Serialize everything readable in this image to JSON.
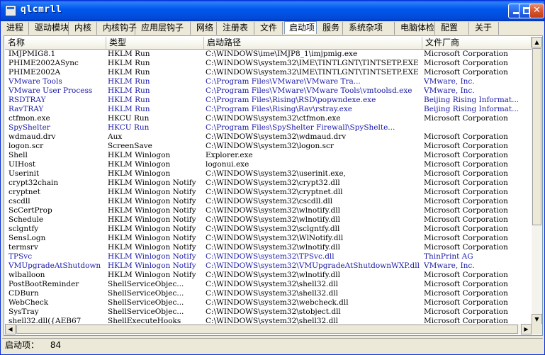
{
  "window": {
    "title": "qlcmrll"
  },
  "tabs": [
    "进程",
    "驱动模块",
    "内核",
    "内核钩子",
    "应用层钩子",
    "网络",
    "注册表",
    "文件",
    "启动项",
    "服务",
    "系统杂项",
    "电脑体检",
    "配置",
    "关于"
  ],
  "active_tab": "启动项",
  "columns": [
    "名称",
    "类型",
    "启动路径",
    "文件厂商"
  ],
  "rows": [
    {
      "name": "IMJPMIG8.1",
      "type": "HKLM Run",
      "path": "C:\\WINDOWS\\ime\\IMJP8_1\\imjpmig.exe",
      "vendor": "Microsoft Corporation",
      "highlight": false
    },
    {
      "name": "PHIME2002ASync",
      "type": "HKLM Run",
      "path": "C:\\WINDOWS\\system32\\IME\\TINTLGNT\\TINTSETP.EXE",
      "vendor": "Microsoft Corporation",
      "highlight": false
    },
    {
      "name": "PHIME2002A",
      "type": "HKLM Run",
      "path": "C:\\WINDOWS\\system32\\IME\\TINTLGNT\\TINTSETP.EXE",
      "vendor": "Microsoft Corporation",
      "highlight": false
    },
    {
      "name": "VMware Tools",
      "type": "HKLM Run",
      "path": "C:\\Program Files\\VMware\\VMware Tra...",
      "vendor": "VMware, Inc.",
      "highlight": true
    },
    {
      "name": "VMware User Process",
      "type": "HKLM Run",
      "path": "C:\\Program Files\\VMware\\VMware Tools\\vmtoolsd.exe",
      "vendor": "VMware, Inc.",
      "highlight": true
    },
    {
      "name": "RSDTRAY",
      "type": "HKLM Run",
      "path": "C:\\Program Files\\Rising\\RSD\\popwndexe.exe",
      "vendor": "Beijing Rising Informat...",
      "highlight": true
    },
    {
      "name": "RavTRAY",
      "type": "HKLM Run",
      "path": "C:\\Program Files\\Rising\\Rav\\rstray.exe",
      "vendor": "Beijing Rising Informat...",
      "highlight": true
    },
    {
      "name": "ctfmon.exe",
      "type": "HKCU Run",
      "path": "C:\\WINDOWS\\system32\\ctfmon.exe",
      "vendor": "Microsoft Corporation",
      "highlight": false
    },
    {
      "name": "SpyShelter",
      "type": "HKCU Run",
      "path": "C:\\Program Files\\SpyShelter Firewall\\SpyShelte...",
      "vendor": "",
      "highlight": true
    },
    {
      "name": "wdmaud.drv",
      "type": "Aux",
      "path": "C:\\WINDOWS\\system32\\wdmaud.drv",
      "vendor": "Microsoft Corporation",
      "highlight": false
    },
    {
      "name": "logon.scr",
      "type": "ScreenSave",
      "path": "C:\\WINDOWS\\system32\\logon.scr",
      "vendor": "Microsoft Corporation",
      "highlight": false
    },
    {
      "name": "Shell",
      "type": "HKLM Winlogon",
      "path": "Explorer.exe",
      "vendor": "Microsoft Corporation",
      "highlight": false
    },
    {
      "name": "UIHost",
      "type": "HKLM Winlogon",
      "path": "logonui.exe",
      "vendor": "Microsoft Corporation",
      "highlight": false
    },
    {
      "name": "Userinit",
      "type": "HKLM Winlogon",
      "path": "C:\\WINDOWS\\system32\\userinit.exe,",
      "vendor": "Microsoft Corporation",
      "highlight": false
    },
    {
      "name": "crypt32chain",
      "type": "HKLM Winlogon Notify",
      "path": "C:\\WINDOWS\\system32\\crypt32.dll",
      "vendor": "Microsoft Corporation",
      "highlight": false
    },
    {
      "name": "cryptnet",
      "type": "HKLM Winlogon Notify",
      "path": "C:\\WINDOWS\\system32\\cryptnet.dll",
      "vendor": "Microsoft Corporation",
      "highlight": false
    },
    {
      "name": "cscdll",
      "type": "HKLM Winlogon Notify",
      "path": "C:\\WINDOWS\\system32\\cscdll.dll",
      "vendor": "Microsoft Corporation",
      "highlight": false
    },
    {
      "name": "ScCertProp",
      "type": "HKLM Winlogon Notify",
      "path": "C:\\WINDOWS\\system32\\wlnotify.dll",
      "vendor": "Microsoft Corporation",
      "highlight": false
    },
    {
      "name": "Schedule",
      "type": "HKLM Winlogon Notify",
      "path": "C:\\WINDOWS\\system32\\wlnotify.dll",
      "vendor": "Microsoft Corporation",
      "highlight": false
    },
    {
      "name": "sclgntfy",
      "type": "HKLM Winlogon Notify",
      "path": "C:\\WINDOWS\\system32\\sclgntfy.dll",
      "vendor": "Microsoft Corporation",
      "highlight": false
    },
    {
      "name": "SensLogn",
      "type": "HKLM Winlogon Notify",
      "path": "C:\\WINDOWS\\system32\\WlNotify.dll",
      "vendor": "Microsoft Corporation",
      "highlight": false
    },
    {
      "name": "termsrv",
      "type": "HKLM Winlogon Notify",
      "path": "C:\\WINDOWS\\system32\\wlnotify.dll",
      "vendor": "Microsoft Corporation",
      "highlight": false
    },
    {
      "name": "TPSvc",
      "type": "HKLM Winlogon Notify",
      "path": "C:\\WINDOWS\\system32\\TPSvc.dll",
      "vendor": "ThinPrint AG",
      "highlight": true
    },
    {
      "name": "VMUpgradeAtShutdown",
      "type": "HKLM Winlogon Notify",
      "path": "C:\\WINDOWS\\system32\\VMUpgradeAtShutdownWXP.dll",
      "vendor": "VMware, Inc.",
      "highlight": true
    },
    {
      "name": "wlballoon",
      "type": "HKLM Winlogon Notify",
      "path": "C:\\WINDOWS\\system32\\wlnotify.dll",
      "vendor": "Microsoft Corporation",
      "highlight": false
    },
    {
      "name": "PostBootReminder",
      "type": "ShellServiceObjec...",
      "path": "C:\\WINDOWS\\system32\\shell32.dll",
      "vendor": "Microsoft Corporation",
      "highlight": false
    },
    {
      "name": "CDBurn",
      "type": "ShellServiceObjec...",
      "path": "C:\\WINDOWS\\system32\\shell32.dll",
      "vendor": "Microsoft Corporation",
      "highlight": false
    },
    {
      "name": "WebCheck",
      "type": "ShellServiceObjec...",
      "path": "C:\\WINDOWS\\system32\\webcheck.dll",
      "vendor": "Microsoft Corporation",
      "highlight": false
    },
    {
      "name": "SysTray",
      "type": "ShellServiceObjec...",
      "path": "C:\\WINDOWS\\system32\\stobject.dll",
      "vendor": "Microsoft Corporation",
      "highlight": false
    },
    {
      "name": "shell32.dll({AEB67",
      "type": "ShellExecuteHooks",
      "path": "C:\\WINDOWS\\system32\\shell32.dll",
      "vendor": "Microsoft Corporation",
      "highlight": false
    }
  ],
  "status": {
    "label": "启动项：",
    "count": "84"
  },
  "colors": {
    "title_bar": "#0058ee",
    "highlight_text": "#1a1aa6",
    "window_bg": "#ece9d8"
  }
}
